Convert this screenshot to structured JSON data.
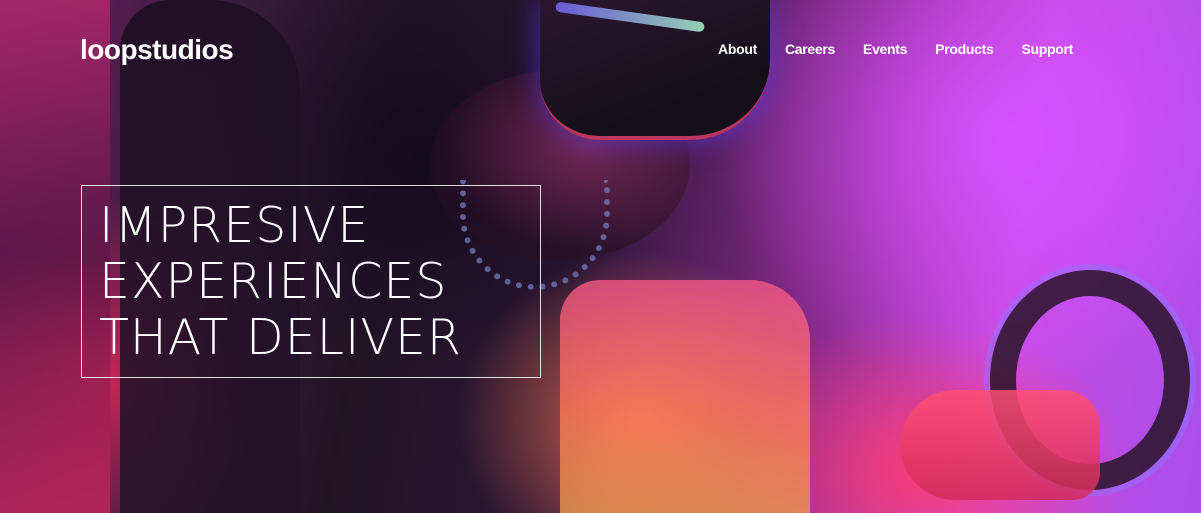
{
  "header": {
    "logo": "loopstudios",
    "nav": [
      {
        "label": "About"
      },
      {
        "label": "Careers"
      },
      {
        "label": "Events"
      },
      {
        "label": "Products"
      },
      {
        "label": "Support"
      }
    ]
  },
  "hero": {
    "headline_lines": [
      "IMPRESIVE",
      "EXPERIENCES",
      "THAT DELIVER"
    ]
  },
  "colors": {
    "text": "#ffffff",
    "accent_magenta": "#d652ff",
    "accent_pink": "#ff3c6e",
    "dark": "#1a0f24"
  }
}
